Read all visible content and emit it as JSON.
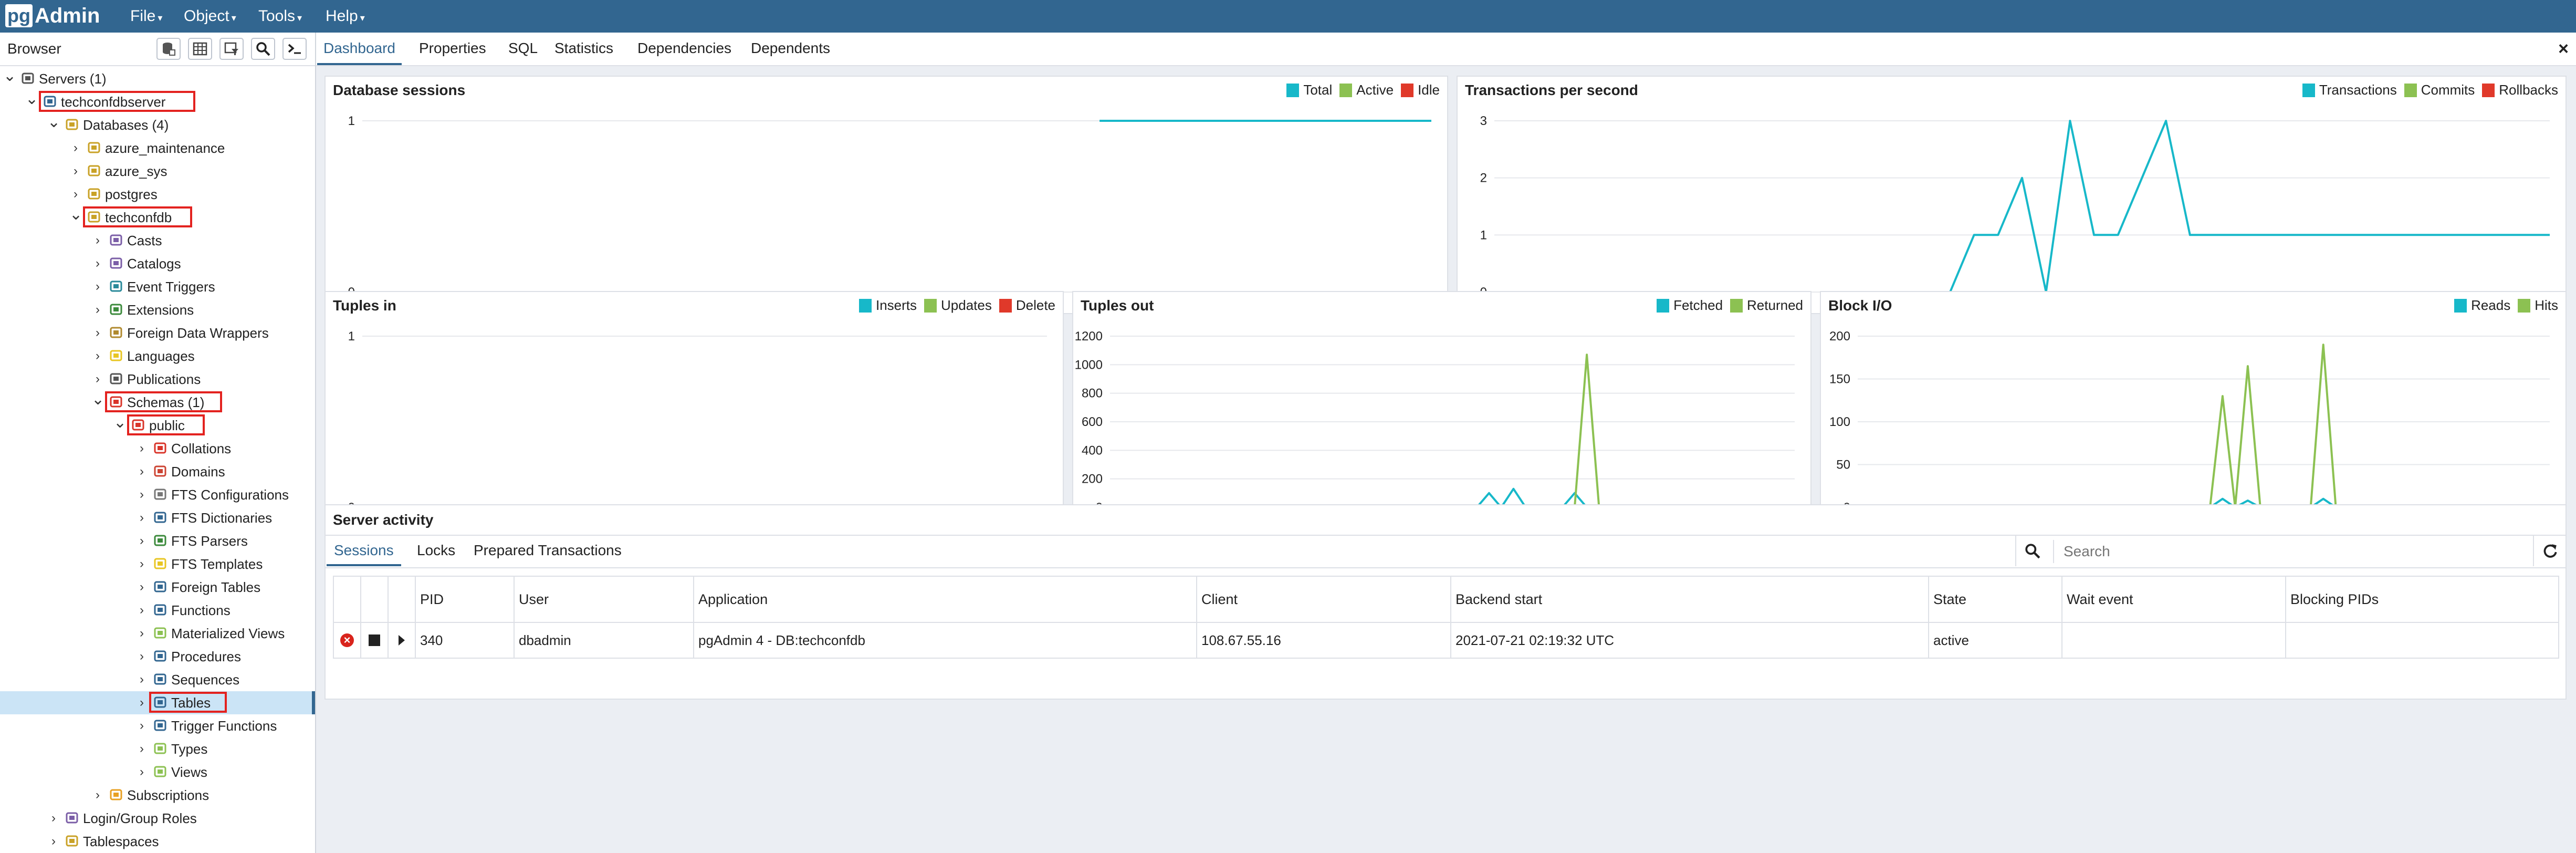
{
  "app": {
    "logo_pg": "pg",
    "logo_admin": "Admin",
    "menu": [
      "File",
      "Object",
      "Tools",
      "Help"
    ]
  },
  "browser": {
    "title": "Browser",
    "tree": [
      {
        "label": "Servers (1)",
        "icon": "servers-icon",
        "expanded": true
      },
      {
        "label": "techconfdbserver",
        "icon": "server-icon",
        "expanded": true,
        "highlighted": true
      },
      {
        "label": "Databases (4)",
        "icon": "databases-icon",
        "expanded": true
      },
      {
        "label": "azure_maintenance",
        "icon": "database-icon",
        "expanded": false
      },
      {
        "label": "azure_sys",
        "icon": "database-icon",
        "expanded": false
      },
      {
        "label": "postgres",
        "icon": "database-icon",
        "expanded": false
      },
      {
        "label": "techconfdb",
        "icon": "database-icon",
        "expanded": true,
        "highlighted": true
      },
      {
        "label": "Casts",
        "icon": "casts-icon",
        "expanded": false
      },
      {
        "label": "Catalogs",
        "icon": "catalogs-icon",
        "expanded": false
      },
      {
        "label": "Event Triggers",
        "icon": "event-triggers-icon",
        "expanded": false
      },
      {
        "label": "Extensions",
        "icon": "extensions-icon",
        "expanded": false
      },
      {
        "label": "Foreign Data Wrappers",
        "icon": "fdw-icon",
        "expanded": false
      },
      {
        "label": "Languages",
        "icon": "languages-icon",
        "expanded": false
      },
      {
        "label": "Publications",
        "icon": "publications-icon",
        "expanded": false
      },
      {
        "label": "Schemas (1)",
        "icon": "schemas-icon",
        "expanded": true,
        "highlighted": true
      },
      {
        "label": "public",
        "icon": "schema-icon",
        "expanded": true,
        "highlighted": true
      },
      {
        "label": "Collations",
        "icon": "collations-icon",
        "expanded": false
      },
      {
        "label": "Domains",
        "icon": "domains-icon",
        "expanded": false
      },
      {
        "label": "FTS Configurations",
        "icon": "fts-configurations-icon",
        "expanded": false
      },
      {
        "label": "FTS Dictionaries",
        "icon": "fts-dictionaries-icon",
        "expanded": false
      },
      {
        "label": "FTS Parsers",
        "icon": "fts-parsers-icon",
        "expanded": false
      },
      {
        "label": "FTS Templates",
        "icon": "fts-templates-icon",
        "expanded": false
      },
      {
        "label": "Foreign Tables",
        "icon": "foreign-tables-icon",
        "expanded": false
      },
      {
        "label": "Functions",
        "icon": "functions-icon",
        "expanded": false
      },
      {
        "label": "Materialized Views",
        "icon": "materialized-views-icon",
        "expanded": false
      },
      {
        "label": "Procedures",
        "icon": "procedures-icon",
        "expanded": false
      },
      {
        "label": "Sequences",
        "icon": "sequences-icon",
        "expanded": false
      },
      {
        "label": "Tables",
        "icon": "tables-icon",
        "expanded": false,
        "highlighted": true,
        "selected": true
      },
      {
        "label": "Trigger Functions",
        "icon": "trigger-functions-icon",
        "expanded": false
      },
      {
        "label": "Types",
        "icon": "types-icon",
        "expanded": false
      },
      {
        "label": "Views",
        "icon": "views-icon",
        "expanded": false
      },
      {
        "label": "Subscriptions",
        "icon": "subscriptions-icon",
        "expanded": false
      },
      {
        "label": "Login/Group Roles",
        "icon": "roles-icon",
        "expanded": false
      },
      {
        "label": "Tablespaces",
        "icon": "tablespaces-icon",
        "expanded": false
      }
    ]
  },
  "main": {
    "tabs": [
      "Dashboard",
      "Properties",
      "SQL",
      "Statistics",
      "Dependencies",
      "Dependents"
    ],
    "active_tab": "Dashboard",
    "close_label": "×"
  },
  "colors": {
    "blue": "#17b8c9",
    "green": "#8cc152",
    "red": "#e0392a",
    "brand": "#326690"
  },
  "chart_data": [
    {
      "type": "line",
      "title": "Database sessions",
      "ylim": [
        0,
        1
      ],
      "yticks": [
        "1",
        "0"
      ],
      "series": [
        {
          "name": "Total",
          "color": "#17b8c9",
          "values": [
            null,
            null,
            null,
            null,
            null,
            null,
            null,
            null,
            null,
            null,
            null,
            null,
            null,
            null,
            null,
            null,
            null,
            null,
            null,
            null,
            1,
            1,
            1,
            1,
            1,
            1,
            1,
            1,
            1,
            1
          ]
        },
        {
          "name": "Active",
          "color": "#8cc152",
          "values": []
        },
        {
          "name": "Idle",
          "color": "#e0392a",
          "values": [
            null,
            null,
            null,
            null,
            null,
            null,
            null,
            null,
            null,
            null,
            null,
            null,
            null,
            null,
            null,
            null,
            null,
            null,
            null,
            null,
            0,
            0,
            0,
            0,
            0,
            0,
            0,
            0,
            0,
            0
          ]
        }
      ]
    },
    {
      "type": "line",
      "title": "Transactions per second",
      "ylim": [
        0,
        3
      ],
      "yticks": [
        "3",
        "2",
        "1",
        "0"
      ],
      "series": [
        {
          "name": "Transactions",
          "color": "#17b8c9",
          "values": [
            null,
            null,
            null,
            null,
            null,
            null,
            null,
            null,
            null,
            null,
            null,
            null,
            null,
            null,
            null,
            null,
            null,
            null,
            null,
            0,
            1,
            1,
            2,
            0,
            3,
            1,
            1,
            2,
            3,
            1,
            1,
            1,
            1,
            1,
            1,
            1,
            1,
            1,
            1,
            1,
            1,
            1,
            1,
            1,
            1
          ]
        },
        {
          "name": "Commits",
          "color": "#8cc152",
          "values": []
        },
        {
          "name": "Rollbacks",
          "color": "#e0392a",
          "values": [
            null,
            null,
            null,
            null,
            null,
            null,
            null,
            null,
            null,
            null,
            null,
            null,
            null,
            null,
            null,
            null,
            null,
            null,
            null,
            0,
            0,
            0,
            0,
            0,
            0,
            0,
            0,
            0,
            0,
            0,
            0,
            0,
            0,
            0,
            0,
            0,
            0,
            0,
            0,
            0,
            0,
            0,
            0,
            0,
            0
          ]
        }
      ]
    },
    {
      "type": "line",
      "title": "Tuples in",
      "ylim": [
        0,
        1
      ],
      "yticks": [
        "1",
        "0"
      ],
      "series": [
        {
          "name": "Inserts",
          "color": "#17b8c9",
          "values": [
            null,
            null,
            null,
            null,
            null,
            null,
            null,
            null,
            null,
            null,
            null,
            null,
            null,
            null,
            null,
            null,
            null,
            null,
            null,
            null,
            0,
            0,
            0,
            0,
            0,
            0,
            0,
            0,
            0,
            0
          ]
        },
        {
          "name": "Updates",
          "color": "#8cc152",
          "values": []
        },
        {
          "name": "Delete",
          "color": "#e0392a",
          "values": []
        }
      ]
    },
    {
      "type": "line",
      "title": "Tuples out",
      "ylim": [
        0,
        1200
      ],
      "yticks": [
        "1200",
        "1000",
        "800",
        "600",
        "400",
        "200",
        "0"
      ],
      "series": [
        {
          "name": "Fetched",
          "color": "#17b8c9",
          "values": [
            null,
            null,
            null,
            null,
            null,
            null,
            null,
            null,
            null,
            null,
            null,
            null,
            null,
            null,
            null,
            null,
            null,
            null,
            null,
            null,
            null,
            null,
            null,
            null,
            null,
            null,
            null,
            null,
            null,
            null,
            0,
            100,
            0,
            130,
            0,
            0,
            0,
            0,
            100,
            0,
            0,
            0,
            0,
            0,
            0,
            0,
            0,
            0,
            0,
            0,
            0,
            0,
            0,
            0,
            0,
            0,
            0
          ]
        },
        {
          "name": "Returned",
          "color": "#8cc152",
          "values": [
            null,
            null,
            null,
            null,
            null,
            null,
            null,
            null,
            null,
            null,
            null,
            null,
            null,
            null,
            null,
            null,
            null,
            null,
            null,
            null,
            null,
            null,
            null,
            null,
            null,
            null,
            null,
            null,
            null,
            null,
            0,
            0,
            0,
            0,
            0,
            0,
            0,
            0,
            0,
            1070,
            0,
            0,
            0,
            0,
            0,
            0,
            0,
            0,
            0,
            0,
            0,
            0,
            0,
            0,
            0,
            0,
            0
          ]
        }
      ]
    },
    {
      "type": "line",
      "title": "Block I/O",
      "ylim": [
        0,
        200
      ],
      "yticks": [
        "200",
        "150",
        "100",
        "50",
        "0"
      ],
      "series": [
        {
          "name": "Reads",
          "color": "#17b8c9",
          "values": [
            null,
            null,
            null,
            null,
            null,
            null,
            null,
            null,
            null,
            null,
            null,
            null,
            null,
            null,
            null,
            null,
            null,
            null,
            null,
            null,
            null,
            null,
            null,
            null,
            null,
            null,
            null,
            null,
            0,
            10,
            0,
            8,
            0,
            2,
            0,
            0,
            0,
            10,
            0,
            0,
            0,
            0,
            0,
            0,
            0,
            0,
            0,
            0,
            0,
            0,
            0,
            0,
            0,
            0,
            0,
            0
          ]
        },
        {
          "name": "Hits",
          "color": "#8cc152",
          "values": [
            null,
            null,
            null,
            null,
            null,
            null,
            null,
            null,
            null,
            null,
            null,
            null,
            null,
            null,
            null,
            null,
            null,
            null,
            null,
            null,
            null,
            null,
            null,
            null,
            null,
            null,
            null,
            null,
            0,
            130,
            0,
            165,
            0,
            0,
            0,
            0,
            0,
            190,
            0,
            0,
            0,
            0,
            0,
            0,
            0,
            0,
            0,
            0,
            0,
            0,
            0,
            0,
            0,
            0,
            0,
            0
          ]
        }
      ]
    }
  ],
  "activity": {
    "title": "Server activity",
    "tabs": [
      "Sessions",
      "Locks",
      "Prepared Transactions"
    ],
    "search_placeholder": "Search",
    "columns": [
      "PID",
      "User",
      "Application",
      "Client",
      "Backend start",
      "State",
      "Wait event",
      "Blocking PIDs"
    ],
    "rows": [
      [
        "340",
        "dbadmin",
        "pgAdmin 4 - DB:techconfdb",
        "108.67.55.16",
        "2021-07-21 02:19:32 UTC",
        "active",
        "",
        ""
      ]
    ]
  }
}
